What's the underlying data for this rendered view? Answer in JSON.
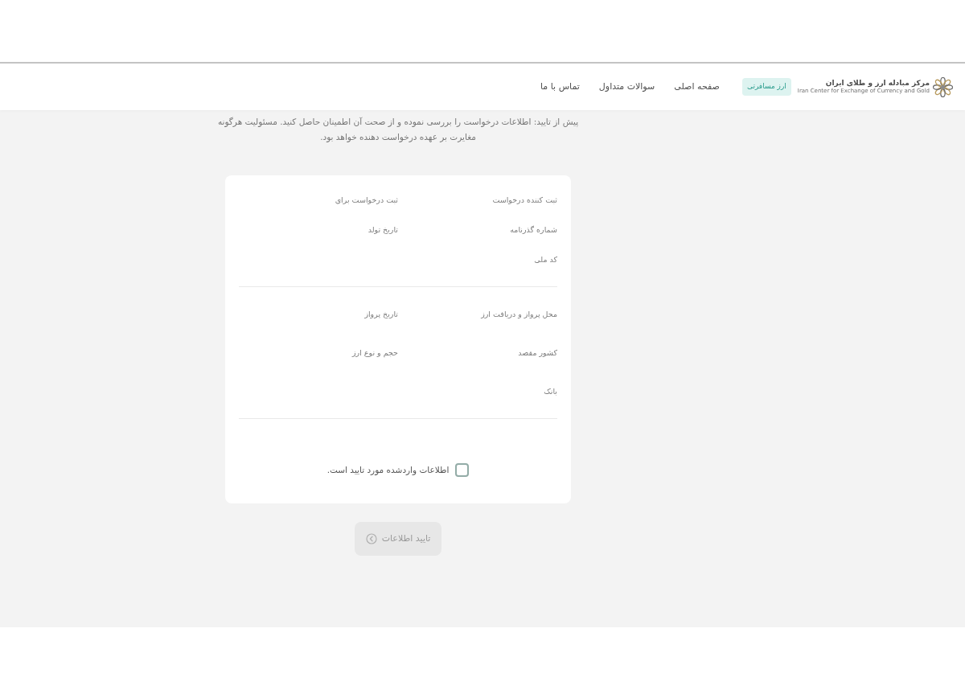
{
  "header": {
    "logo": {
      "title": "مرکز مبادله ارز و طلای ایران",
      "subtitle": "Iran Center for Exchange of Currency and Gold"
    },
    "badge": "ارز مسافرتی",
    "nav_links": [
      "صفحه اصلی",
      "سوالات متداول",
      "تماس با ما"
    ]
  },
  "notice": "پیش از تایید: اطلاعات درخواست را بررسی نموده و از صحت آن اطمینان حاصل کنید. مسئولیت هرگونه مغایرت بر عهده درخواست دهنده خواهد بود.",
  "summary": {
    "sections": [
      {
        "fields": [
          "ثبت کننده درخواست",
          "ثبت درخواست برای",
          "شماره گذرنامه",
          "تاریخ تولد",
          "کد ملی"
        ]
      },
      {
        "fields": [
          "محل پرواز و دریافت ارز",
          "تاریخ پرواز",
          "کشور مقصد",
          "حجم و نوع ارز",
          "بانک"
        ]
      }
    ]
  },
  "confirmation": {
    "label": "اطلاعات واردشده مورد تایید است.",
    "checked": false
  },
  "submit_button": {
    "label": "تایید اطلاعات",
    "disabled": true
  }
}
